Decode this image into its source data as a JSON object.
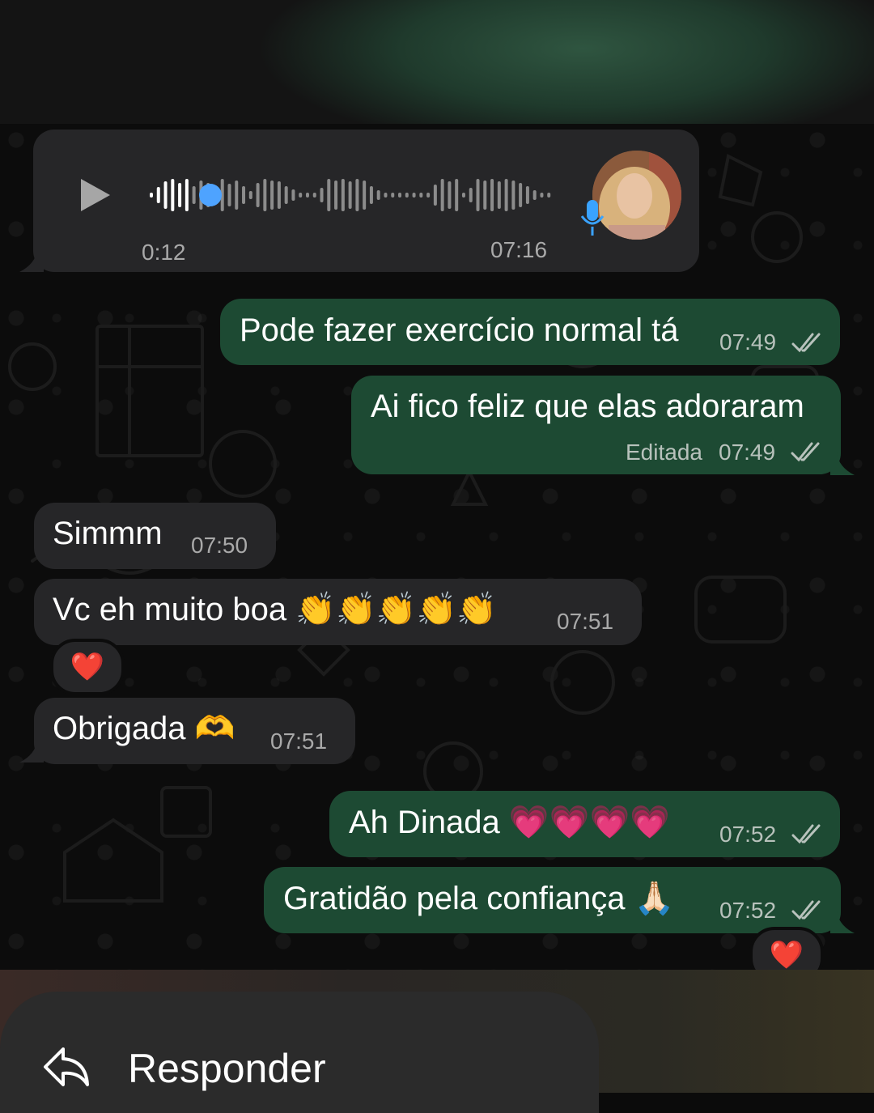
{
  "voice_message": {
    "duration": "0:12",
    "time": "07:16",
    "progress": 0.1
  },
  "messages": [
    {
      "text": "Pode fazer exercício normal tá",
      "time": "07:49"
    },
    {
      "text": "Ai fico feliz que elas adoraram",
      "edited_label": "Editada",
      "time": "07:49"
    },
    {
      "text": "Simmm",
      "time": "07:50"
    },
    {
      "text": "Vc eh muito boa 👏👏👏👏👏",
      "time": "07:51",
      "reaction": "❤️"
    },
    {
      "text": "Obrigada 🫶",
      "time": "07:51"
    },
    {
      "text": "Ah Dinada 💗💗💗💗",
      "time": "07:52"
    },
    {
      "text": "Gratidão pela confiança 🙏🏻",
      "time": "07:52",
      "reaction": "❤️"
    }
  ],
  "reply": {
    "label": "Responder"
  },
  "colors": {
    "incoming_bubble": "#262628",
    "outgoing_bubble": "#1d4a33",
    "play_head": "#4ea3ff",
    "mic": "#3aa3ff"
  }
}
